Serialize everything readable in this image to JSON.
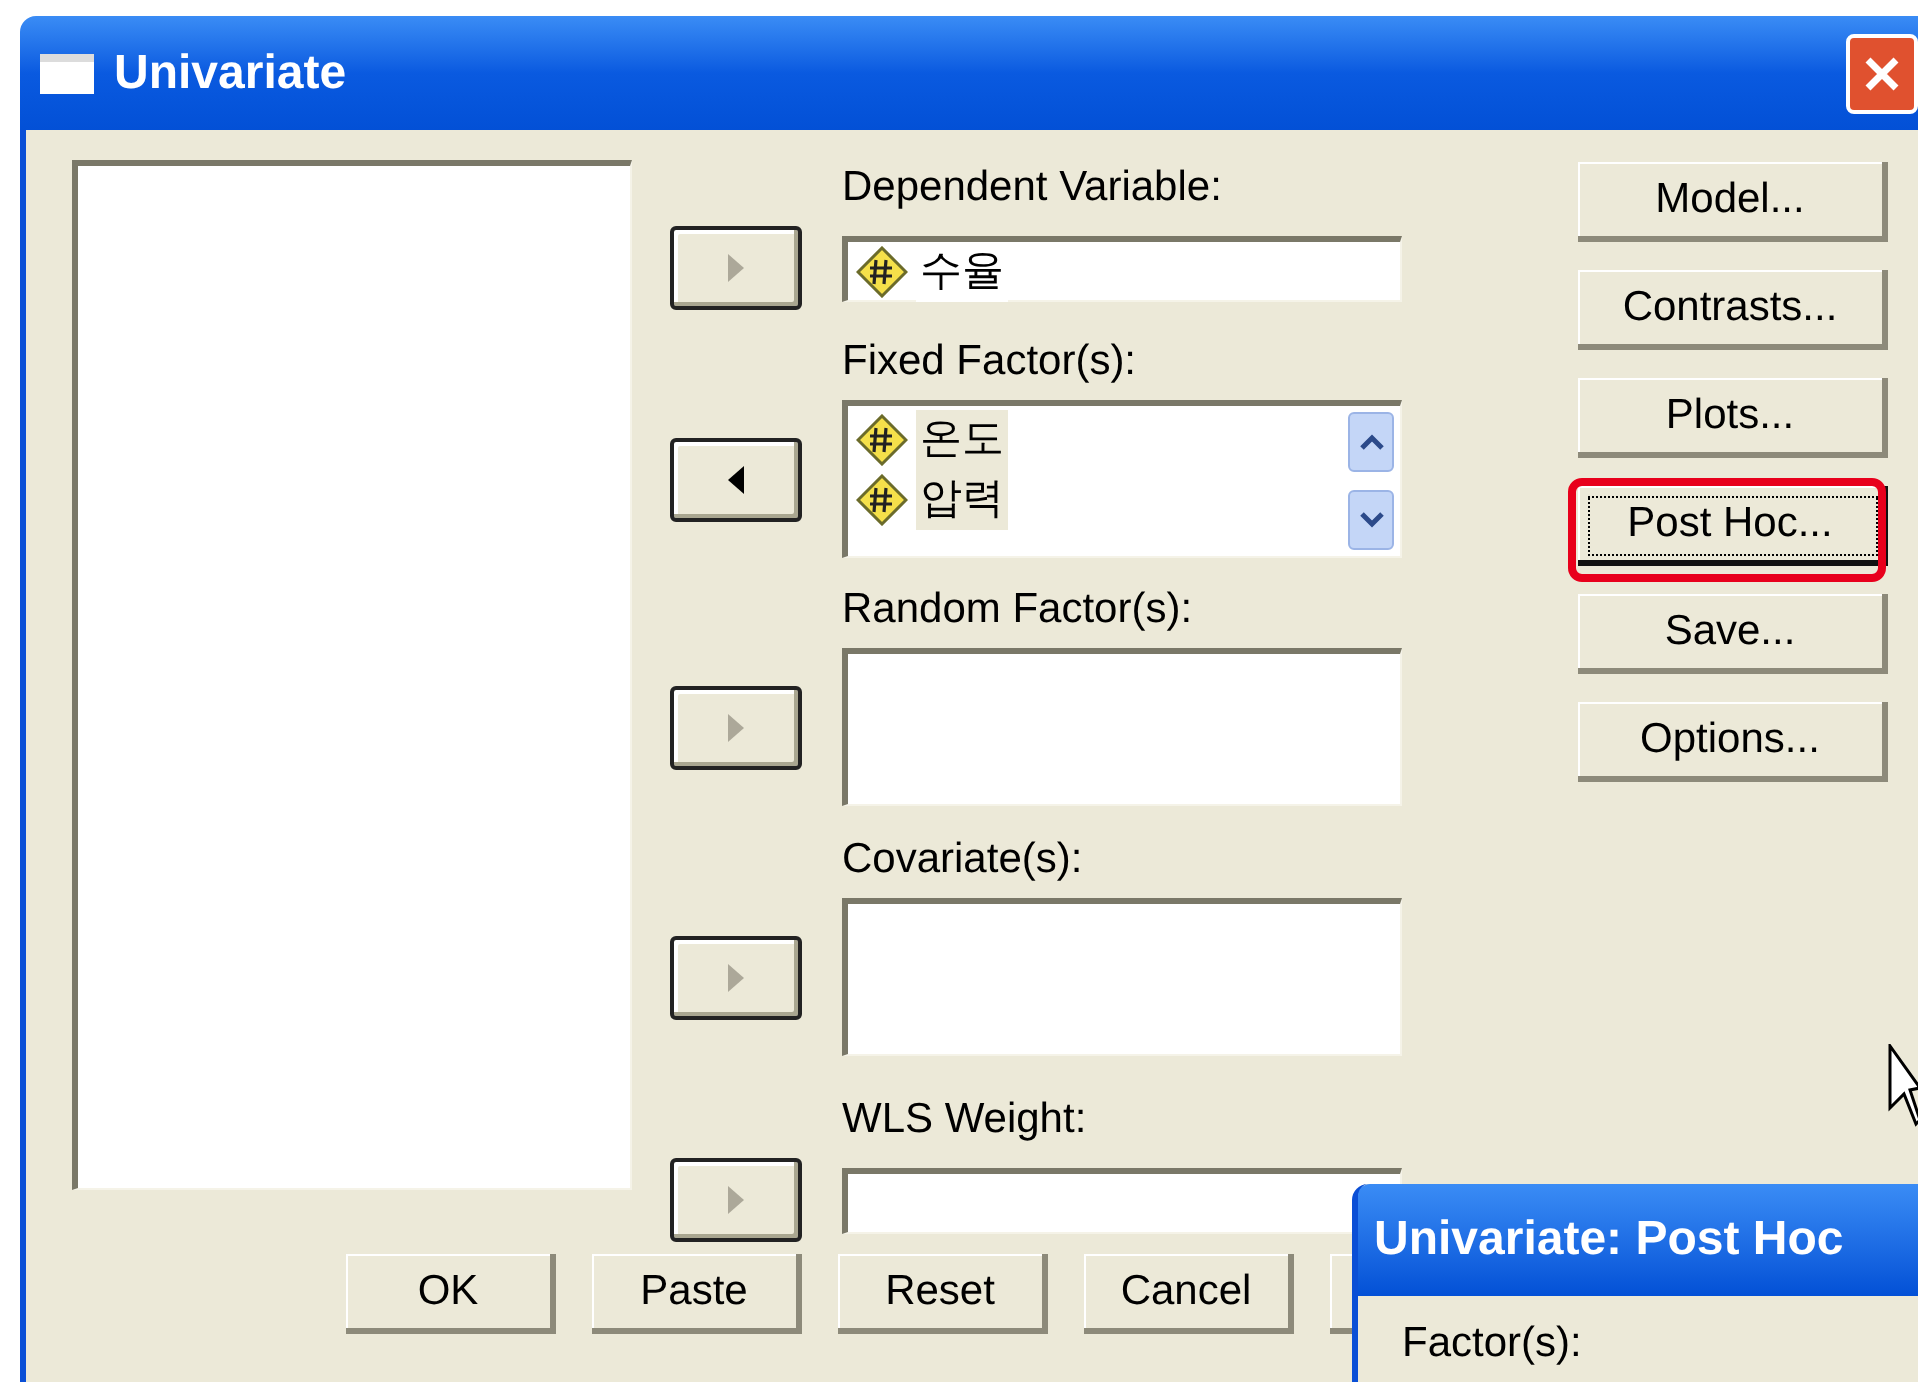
{
  "window": {
    "title": "Univariate"
  },
  "targets": [
    {
      "kind": "field",
      "label": "Dependent Variable:",
      "items": [
        {
          "name": "수율",
          "selected": false
        }
      ],
      "arrow_points_left": false,
      "arrow_enabled": false
    },
    {
      "kind": "list",
      "label": "Fixed Factor(s):",
      "items": [
        {
          "name": "온도",
          "selected": true
        },
        {
          "name": "압력",
          "selected": true
        }
      ],
      "arrow_points_left": true,
      "arrow_enabled": true
    },
    {
      "kind": "box",
      "label": "Random Factor(s):",
      "arrow_points_left": false,
      "arrow_enabled": false
    },
    {
      "kind": "box",
      "label": "Covariate(s):",
      "arrow_points_left": false,
      "arrow_enabled": false
    },
    {
      "kind": "field",
      "label": "WLS Weight:",
      "arrow_points_left": false,
      "arrow_enabled": false
    }
  ],
  "side_buttons": [
    {
      "label": "Model...",
      "focused": false,
      "highlighted": false
    },
    {
      "label": "Contrasts...",
      "focused": false,
      "highlighted": false
    },
    {
      "label": "Plots...",
      "focused": false,
      "highlighted": false
    },
    {
      "label": "Post Hoc...",
      "focused": true,
      "highlighted": true
    },
    {
      "label": "Save...",
      "focused": false,
      "highlighted": false
    },
    {
      "label": "Options...",
      "focused": false,
      "highlighted": false
    }
  ],
  "bottom_buttons": [
    "OK",
    "Paste",
    "Reset",
    "Cancel"
  ],
  "popup": {
    "title": "Univariate: Post Hoc",
    "factors_label": "Factor(s):"
  }
}
